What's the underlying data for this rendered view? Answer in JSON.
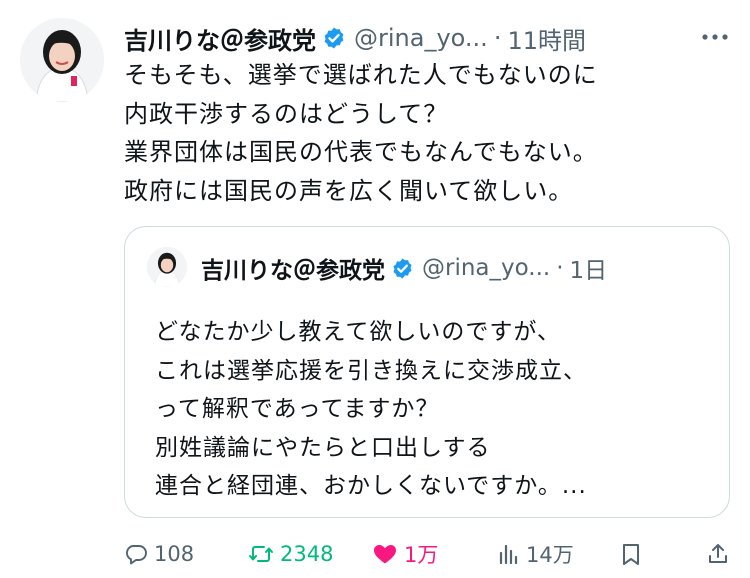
{
  "tweet": {
    "author_name": "吉川りな＠参政党",
    "handle": "@rina_yo...",
    "separator": "·",
    "time": "11時間",
    "lines": [
      "そもそも、選挙で選ばれた人でもないのに",
      "内政干渉するのはどうして？",
      "業界団体は国民の代表でもなんでもない。",
      "政府には国民の声を広く聞いて欲しい。"
    ]
  },
  "quoted": {
    "author_name": "吉川りな＠参政党",
    "handle": "@rina_yo...",
    "separator": "·",
    "time": "1日",
    "lines": [
      "どなたか少し教えて欲しいのですが、",
      "これは選挙応援を引き換えに交渉成立、",
      "って解釈であってますか？",
      "別姓議論にやたらと口出しする",
      "連合と経団連、おかしくないですか。..."
    ]
  },
  "actions": {
    "replies": "108",
    "retweets": "2348",
    "likes": "1万",
    "views": "14万"
  },
  "colors": {
    "text": "#0f1419",
    "muted": "#536471",
    "verified": "#1d9bf0",
    "retweet": "#00ba7c",
    "like": "#f91880",
    "border": "#cfd9de"
  },
  "icons": [
    "avatar",
    "verified-badge-icon",
    "more-icon",
    "reply-icon",
    "retweet-icon",
    "like-icon",
    "views-icon",
    "bookmark-icon",
    "share-icon"
  ]
}
